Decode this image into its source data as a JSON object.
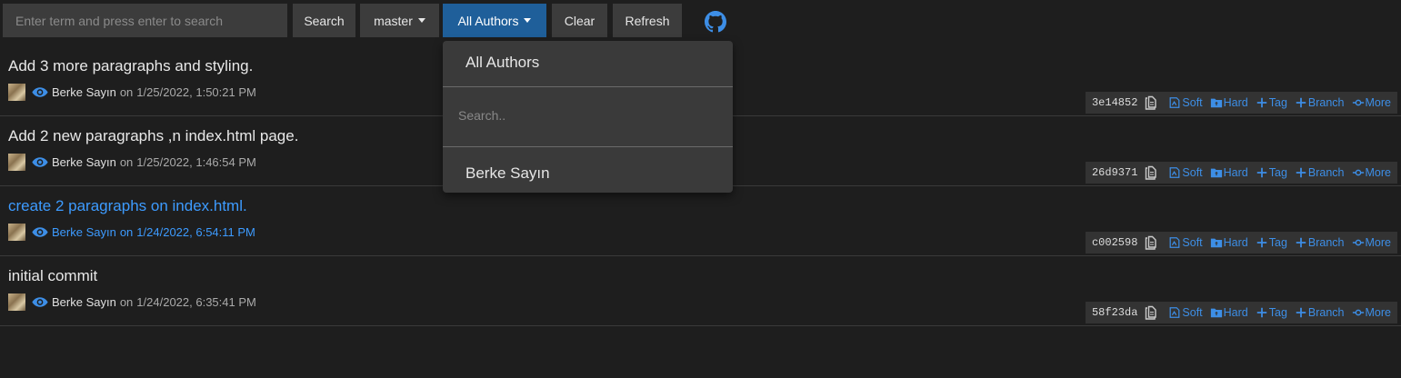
{
  "toolbar": {
    "search_placeholder": "Enter term and press enter to search",
    "search_label": "Search",
    "branch_label": "master",
    "authors_label": "All Authors",
    "clear_label": "Clear",
    "refresh_label": "Refresh",
    "github_icon": "github-icon"
  },
  "author_dropdown": {
    "all_label": "All Authors",
    "search_placeholder": "Search..",
    "authors": [
      "Berke Sayın"
    ]
  },
  "commits": [
    {
      "message": "Add 3 more paragraphs and styling.",
      "author": "Berke Sayın",
      "on": "on",
      "date": "1/25/2022, 1:50:21 PM",
      "hash": "3e14852",
      "highlighted": false
    },
    {
      "message": "Add 2 new paragraphs ,n index.html page.",
      "author": "Berke Sayın",
      "on": "on",
      "date": "1/25/2022, 1:46:54 PM",
      "hash": "26d9371",
      "highlighted": false
    },
    {
      "message": "create 2 paragraphs on index.html.",
      "author": "Berke Sayın",
      "on": "on",
      "date": "1/24/2022, 6:54:11 PM",
      "hash": "c002598",
      "highlighted": true
    },
    {
      "message": "initial commit",
      "author": "Berke Sayın",
      "on": "on",
      "date": "1/24/2022, 6:35:41 PM",
      "hash": "58f23da",
      "highlighted": false
    }
  ],
  "actions": {
    "soft": "Soft",
    "hard": "Hard",
    "tag": "Tag",
    "branch": "Branch",
    "more": "More"
  },
  "colors": {
    "accent": "#3d8ee6",
    "primary_button": "#1f5f9a",
    "background": "#1e1e1e"
  }
}
